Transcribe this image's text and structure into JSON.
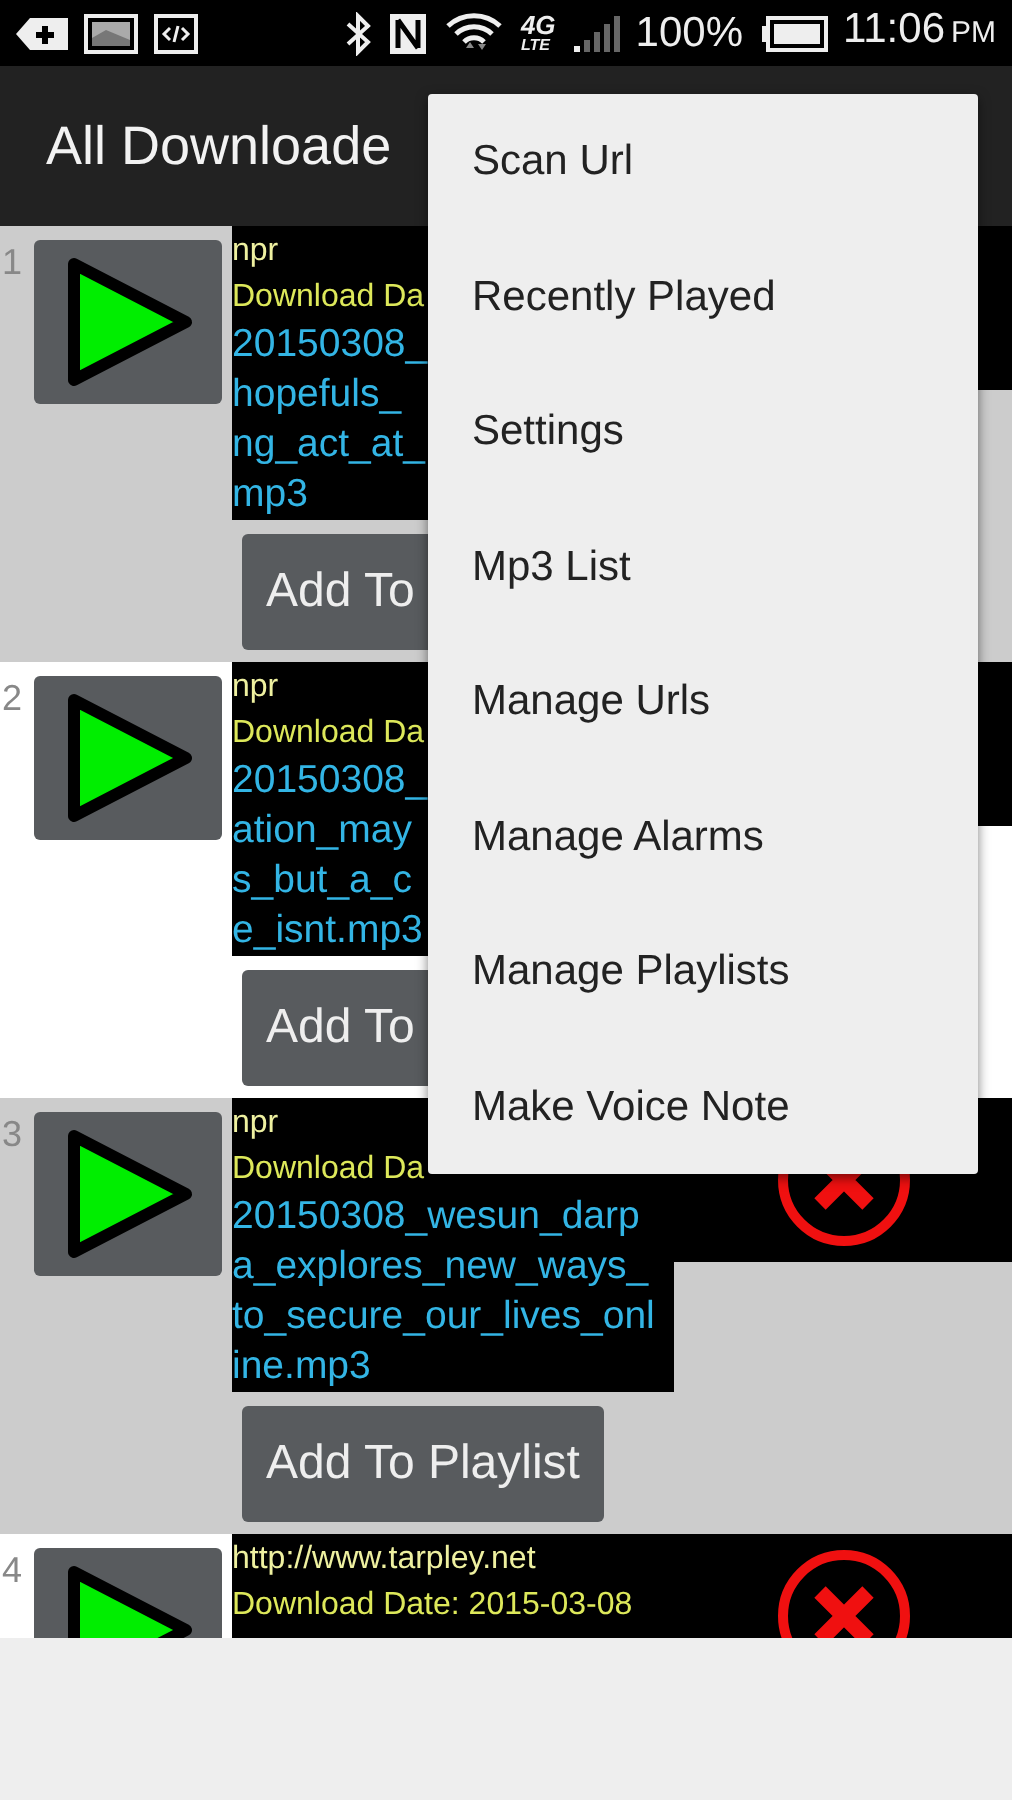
{
  "status_bar": {
    "network": "4G",
    "network_sub": "LTE",
    "battery": "100%",
    "time": "11:06",
    "ampm": "PM"
  },
  "app_bar": {
    "title": "All Downloade"
  },
  "rows": [
    {
      "number": "1",
      "source": "npr",
      "date": "Download Da",
      "filename_lines": [
        "20150308_",
        "hopefuls_",
        "ng_act_at_",
        "mp3"
      ],
      "button": "Add To"
    },
    {
      "number": "2",
      "source": "npr",
      "date": "Download Da",
      "filename_lines": [
        "20150308_",
        "ation_may",
        "s_but_a_c",
        "e_isnt.mp3"
      ],
      "button": "Add To"
    },
    {
      "number": "3",
      "source": "npr",
      "date": "Download Da",
      "filename_lines": [
        "20150308_wesun_darp",
        "a_explores_new_ways_",
        "to_secure_our_lives_onl",
        "ine.mp3"
      ],
      "button": "Add To Playlist",
      "delete_icon": true
    },
    {
      "number": "4",
      "source": "http://www.tarpley.net",
      "date": "Download Date: 2015-03-08",
      "delete_icon": true
    }
  ],
  "menu": [
    {
      "label": "Scan Url"
    },
    {
      "label": "Recently Played"
    },
    {
      "label": "Settings"
    },
    {
      "label": "Mp3 List"
    },
    {
      "label": "Manage Urls"
    },
    {
      "label": "Manage Alarms"
    },
    {
      "label": "Manage Playlists"
    },
    {
      "label": "Make Voice Note"
    }
  ]
}
